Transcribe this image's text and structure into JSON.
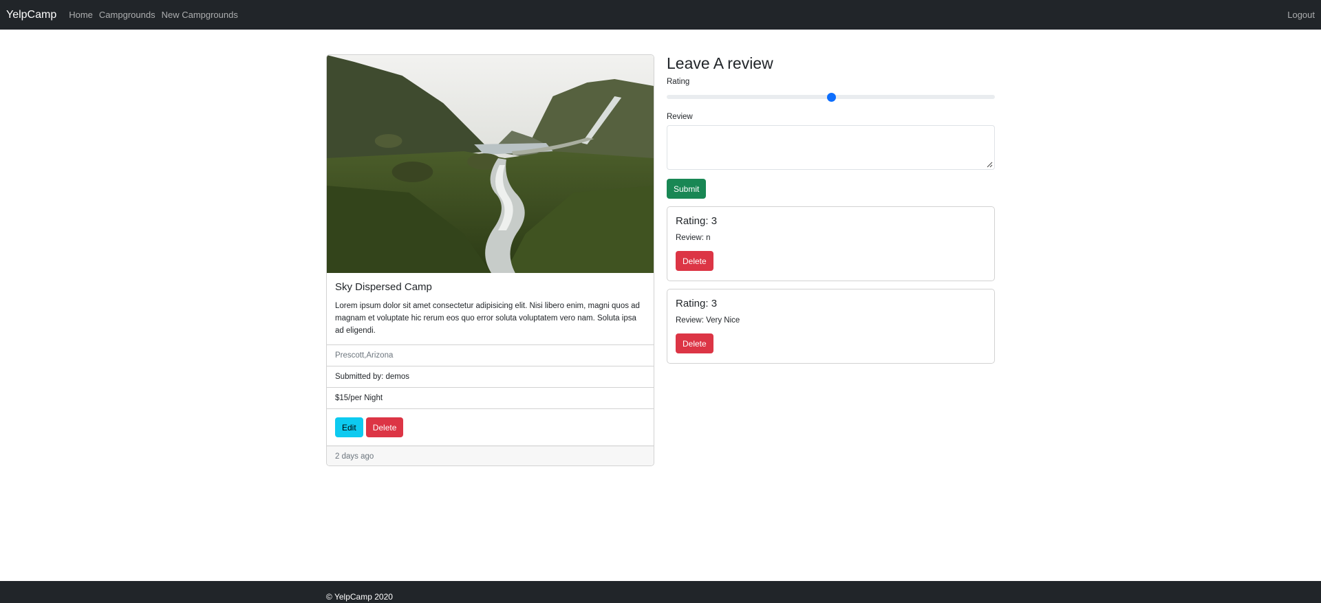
{
  "navbar": {
    "brand": "YelpCamp",
    "links": [
      "Home",
      "Campgrounds",
      "New Campgrounds"
    ],
    "logout": "Logout"
  },
  "campground": {
    "title": "Sky Dispersed Camp",
    "description": "Lorem ipsum dolor sit amet consectetur adipisicing elit. Nisi libero enim, magni quos ad magnam et voluptate hic rerum eos quo error soluta voluptatem vero nam. Soluta ipsa ad eligendi.",
    "location": "Prescott,Arizona",
    "submitted_by": "Submitted by: demos",
    "price": "$15/per Night",
    "edit_label": "Edit",
    "delete_label": "Delete",
    "posted": "2 days ago"
  },
  "review_form": {
    "heading": "Leave A review",
    "rating_label": "Rating",
    "rating_value": 3,
    "rating_min": 1,
    "rating_max": 5,
    "review_label": "Review",
    "review_value": "",
    "submit_label": "Submit"
  },
  "reviews": [
    {
      "rating": "Rating: 3",
      "text": "Review: n",
      "delete_label": "Delete"
    },
    {
      "rating": "Rating: 3",
      "text": "Review: Very Nice",
      "delete_label": "Delete"
    }
  ],
  "footer": {
    "text": "© YelpCamp 2020"
  },
  "colors": {
    "navbar": "#212529",
    "info": "#0dcaf0",
    "danger": "#dc3545",
    "success": "#198754",
    "primary": "#0d6efd"
  }
}
